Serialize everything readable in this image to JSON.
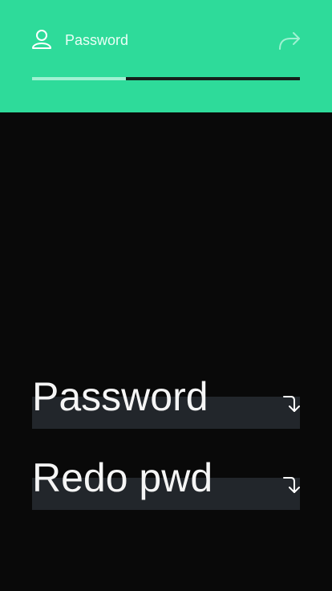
{
  "header": {
    "title": "Password",
    "background": "#2edb9a",
    "user_icon": "user-icon",
    "next_icon": "forward-arrow-icon"
  },
  "progress": {
    "fraction": 0.35,
    "fill_color": "#9ff2d2",
    "track_color": "#14201b"
  },
  "fields": [
    {
      "label": "Password",
      "icon": "enter-arrow-icon"
    },
    {
      "label": "Redo pwd",
      "icon": "enter-arrow-icon"
    }
  ],
  "colors": {
    "page_background": "#090909",
    "field_background": "#22262b",
    "text": "#f5f5f5"
  }
}
